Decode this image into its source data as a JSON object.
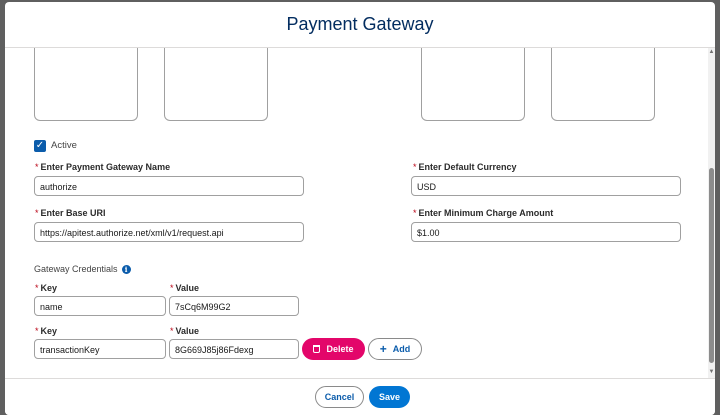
{
  "header": {
    "title": "Payment Gateway"
  },
  "form": {
    "active": {
      "label": "Active",
      "checked": true
    },
    "gateway_name": {
      "label": "Enter Payment Gateway Name",
      "value": "authorize"
    },
    "default_currency": {
      "label": "Enter Default Currency",
      "value": "USD"
    },
    "base_uri": {
      "label": "Enter Base URI",
      "value": "https://apitest.authorize.net/xml/v1/request.api"
    },
    "min_charge": {
      "label": "Enter Minimum Charge Amount",
      "value": "$1.00"
    }
  },
  "credentials": {
    "title": "Gateway Credentials",
    "rows": [
      {
        "key_label": "Key",
        "key_value": "name",
        "value_label": "Value",
        "value_value": "7sCq6M99G2"
      },
      {
        "key_label": "Key",
        "key_value": "transactionKey",
        "value_label": "Value",
        "value_value": "8G669J85j86Fdexg"
      }
    ],
    "delete_label": "Delete",
    "add_label": "Add"
  },
  "footer": {
    "cancel_label": "Cancel",
    "save_label": "Save"
  },
  "required_marker": "*",
  "colors": {
    "brand": "#0176d3",
    "title": "#032d60",
    "delete": "#e3066a",
    "required": "#ba0517"
  }
}
